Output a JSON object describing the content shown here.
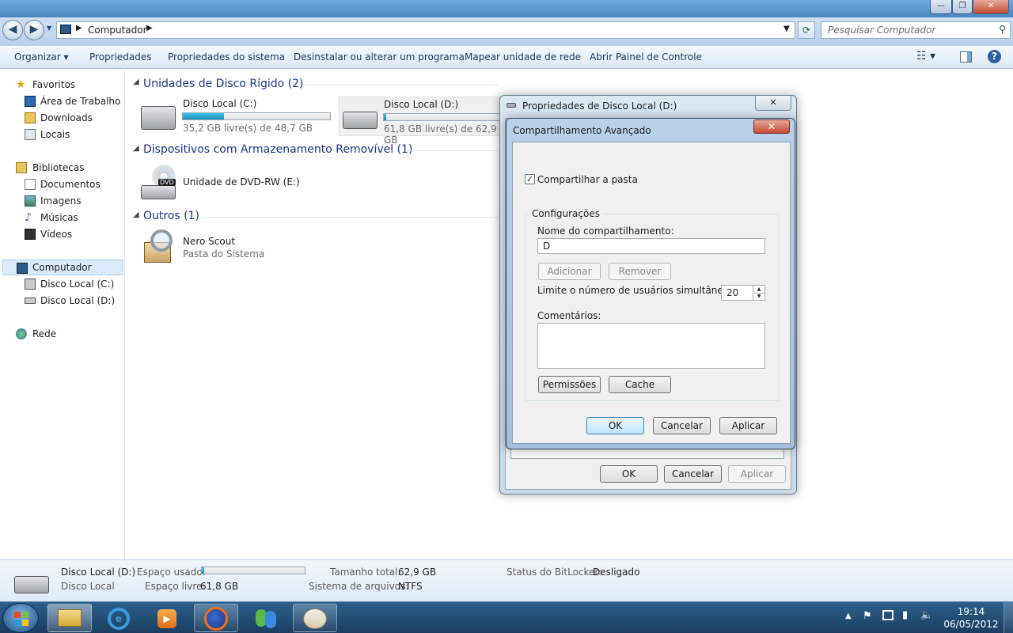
{
  "window": {
    "minimize": "—",
    "maximize": "❐",
    "close": "✕"
  },
  "address": {
    "path": "Computador",
    "search_placeholder": "Pesquisar Computador"
  },
  "toolbar": {
    "items": [
      "Organizar",
      "Propriedades",
      "Propriedades do sistema",
      "Desinstalar ou alterar um programa",
      "Mapear unidade de rede",
      "Abrir Painel de Controle"
    ]
  },
  "sidebar": {
    "favorites": "Favoritos",
    "fav_items": [
      "Área de Trabalho",
      "Downloads",
      "Locais"
    ],
    "libraries": "Bibliotecas",
    "lib_items": [
      "Documentos",
      "Imagens",
      "Músicas",
      "Vídeos"
    ],
    "computer": "Computador",
    "comp_items": [
      "Disco Local (C:)",
      "Disco Local (D:)"
    ],
    "network": "Rede"
  },
  "content": {
    "hard_disks": "Unidades de Disco Rígido (2)",
    "drive_c": {
      "name": "Disco Local (C:)",
      "free": "35,2 GB livre(s) de 48,7 GB",
      "used_fraction": 0.28
    },
    "drive_d": {
      "name": "Disco Local (D:)",
      "free": "61,8 GB livre(s) de 62,9 GB",
      "used_fraction": 0.02
    },
    "removable": "Dispositivos com Armazenamento Removível (1)",
    "dvd": {
      "name": "Unidade de DVD-RW (E:)",
      "badge": "DVD"
    },
    "others": "Outros (1)",
    "nero": {
      "name": "Nero Scout",
      "sub": "Pasta do Sistema"
    }
  },
  "details": {
    "name": "Disco Local (D:)",
    "type": "Disco Local",
    "used_label": "Espaço usado:",
    "free_label": "Espaço livre:",
    "free_value": "61,8 GB",
    "size_label": "Tamanho total:",
    "size_value": "62,9 GB",
    "fs_label": "Sistema de arquivos:",
    "fs_value": "NTFS",
    "bitlocker_label": "Status do BitLocker:",
    "bitlocker_value": "Desligado",
    "used_fraction": 0.02
  },
  "props_dialog": {
    "title": "Propriedades de Disco Local (D:)",
    "ok": "OK",
    "cancel": "Cancelar",
    "apply": "Aplicar"
  },
  "adv_dialog": {
    "title": "Compartilhamento Avançado",
    "share_checkbox": "Compartilhar a pasta",
    "settings": "Configurações",
    "share_name_label": "Nome do compartilhamento:",
    "share_name_value": "D",
    "add": "Adicionar",
    "remove": "Remover",
    "limit_label": "Limite o número de usuários simultâneos a:",
    "limit_value": "20",
    "comments_label": "Comentários:",
    "permissions": "Permissões",
    "cache": "Cache",
    "ok": "OK",
    "cancel": "Cancelar",
    "apply": "Aplicar"
  },
  "tray": {
    "time": "19:14",
    "date": "06/05/2012"
  }
}
